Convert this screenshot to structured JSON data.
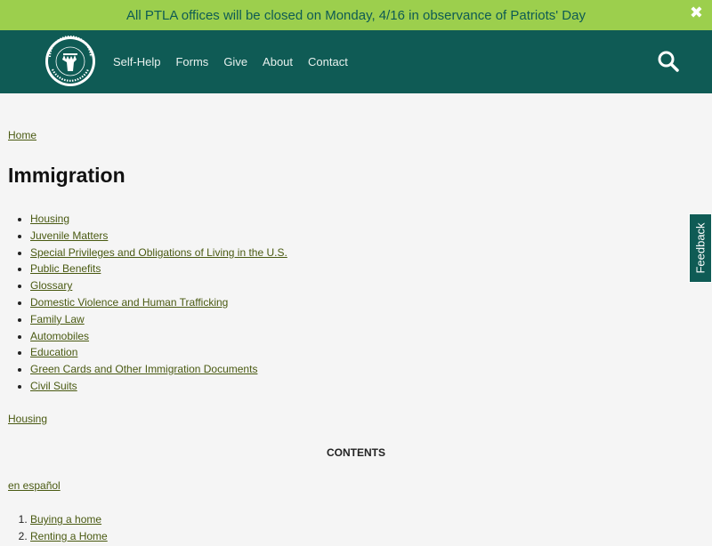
{
  "alert": {
    "message": "All PTLA offices will be closed on Monday, 4/16 in observance of Patriots' Day",
    "close_glyph": "✖"
  },
  "header": {
    "logo_icon": "pine-tree-legal-moose-logo-icon",
    "nav": [
      {
        "label": "Self-Help"
      },
      {
        "label": "Forms"
      },
      {
        "label": "Give"
      },
      {
        "label": "About"
      },
      {
        "label": "Contact"
      }
    ],
    "search_icon": "search-icon"
  },
  "breadcrumb": {
    "home": "Home"
  },
  "page": {
    "title": "Immigration",
    "categories": [
      "Housing",
      "Juvenile Matters",
      "Special Privileges and Obligations of Living in the U.S.",
      "Public Benefits",
      "Glossary",
      "Domestic Violence and Human Trafficking",
      "Family Law",
      "Automobiles",
      "Education",
      "Green Cards and Other Immigration Documents",
      "Civil Suits"
    ],
    "section_link": "Housing",
    "contents_heading": "CONTENTS",
    "language_link": "en español",
    "toc": [
      "Buying a home",
      "Renting a Home"
    ]
  },
  "feedback": {
    "label": "Feedback"
  },
  "colors": {
    "alert_bg": "#9ccf4d",
    "header_bg": "#0f5b55",
    "link": "#4a5a12"
  }
}
